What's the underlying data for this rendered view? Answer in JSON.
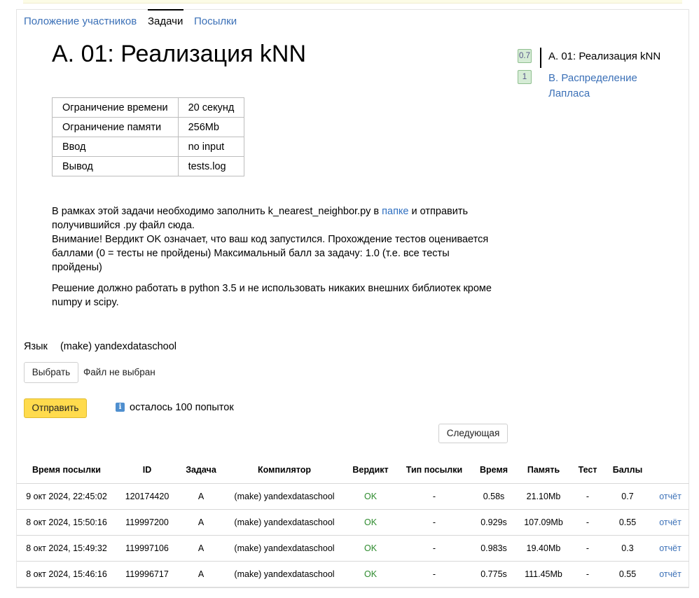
{
  "tabs": [
    {
      "label": "Положение участников",
      "active": false
    },
    {
      "label": "Задачи",
      "active": true
    },
    {
      "label": "Посылки",
      "active": false
    }
  ],
  "problem": {
    "title": "А. 01: Реализация kNN",
    "limits": [
      {
        "key": "Ограничение времени",
        "value": "20 секунд"
      },
      {
        "key": "Ограничение памяти",
        "value": "256Mb"
      },
      {
        "key": "Ввод",
        "value": "no input"
      },
      {
        "key": "Вывод",
        "value": "tests.log"
      }
    ],
    "statement": {
      "p1_before_link": "В рамках этой задачи необходимо заполнить k_nearest_neighbor.py в ",
      "p1_link": "папке",
      "p1_after_link": " и отправить получившийся .py файл сюда.",
      "p1_line2": "Внимание! Вердикт OK означает, что ваш код запустился. Прохождение тестов оценивается баллами (0 = тесты не пройдены) Максимальный балл за задачу: 1.0 (т.е. все тесты пройдены)",
      "p2": "Решение должно работать в python 3.5 и не использовать никаких внешних библиотек кроме numpy и scipy."
    }
  },
  "sidebar": {
    "items": [
      {
        "score": "0.7",
        "label": "А. 01: Реализация kNN",
        "current": true
      },
      {
        "score": "1",
        "label_line1": "B. Распределение",
        "label_line2": "Лапласа",
        "current": false
      }
    ]
  },
  "submit_form": {
    "language_label": "Язык",
    "language_value": "(make) yandexdataschool",
    "choose_button": "Выбрать",
    "file_status": "Файл не выбран",
    "send_button": "Отправить",
    "info_icon": "i",
    "attempts_left": "осталось 100 попыток",
    "next_button": "Следующая"
  },
  "submissions": {
    "columns": [
      "Время посылки",
      "ID",
      "Задача",
      "Компилятор",
      "Вердикт",
      "Тип посылки",
      "Время",
      "Память",
      "Тест",
      "Баллы",
      ""
    ],
    "rows": [
      {
        "time": "9 окт 2024, 22:45:02",
        "id": "120174420",
        "task": "A",
        "compiler": "(make) yandexdataschool",
        "verdict": "OK",
        "type": "-",
        "runtime": "0.58s",
        "memory": "21.10Mb",
        "test": "-",
        "score": "0.7",
        "report": "отчёт"
      },
      {
        "time": "8 окт 2024, 15:50:16",
        "id": "119997200",
        "task": "A",
        "compiler": "(make) yandexdataschool",
        "verdict": "OK",
        "type": "-",
        "runtime": "0.929s",
        "memory": "107.09Mb",
        "test": "-",
        "score": "0.55",
        "report": "отчёт"
      },
      {
        "time": "8 окт 2024, 15:49:32",
        "id": "119997106",
        "task": "A",
        "compiler": "(make) yandexdataschool",
        "verdict": "OK",
        "type": "-",
        "runtime": "0.983s",
        "memory": "19.40Mb",
        "test": "-",
        "score": "0.3",
        "report": "отчёт"
      },
      {
        "time": "8 окт 2024, 15:46:16",
        "id": "119996717",
        "task": "A",
        "compiler": "(make) yandexdataschool",
        "verdict": "OK",
        "type": "-",
        "runtime": "0.775s",
        "memory": "111.45Mb",
        "test": "-",
        "score": "0.55",
        "report": "отчёт"
      }
    ]
  }
}
